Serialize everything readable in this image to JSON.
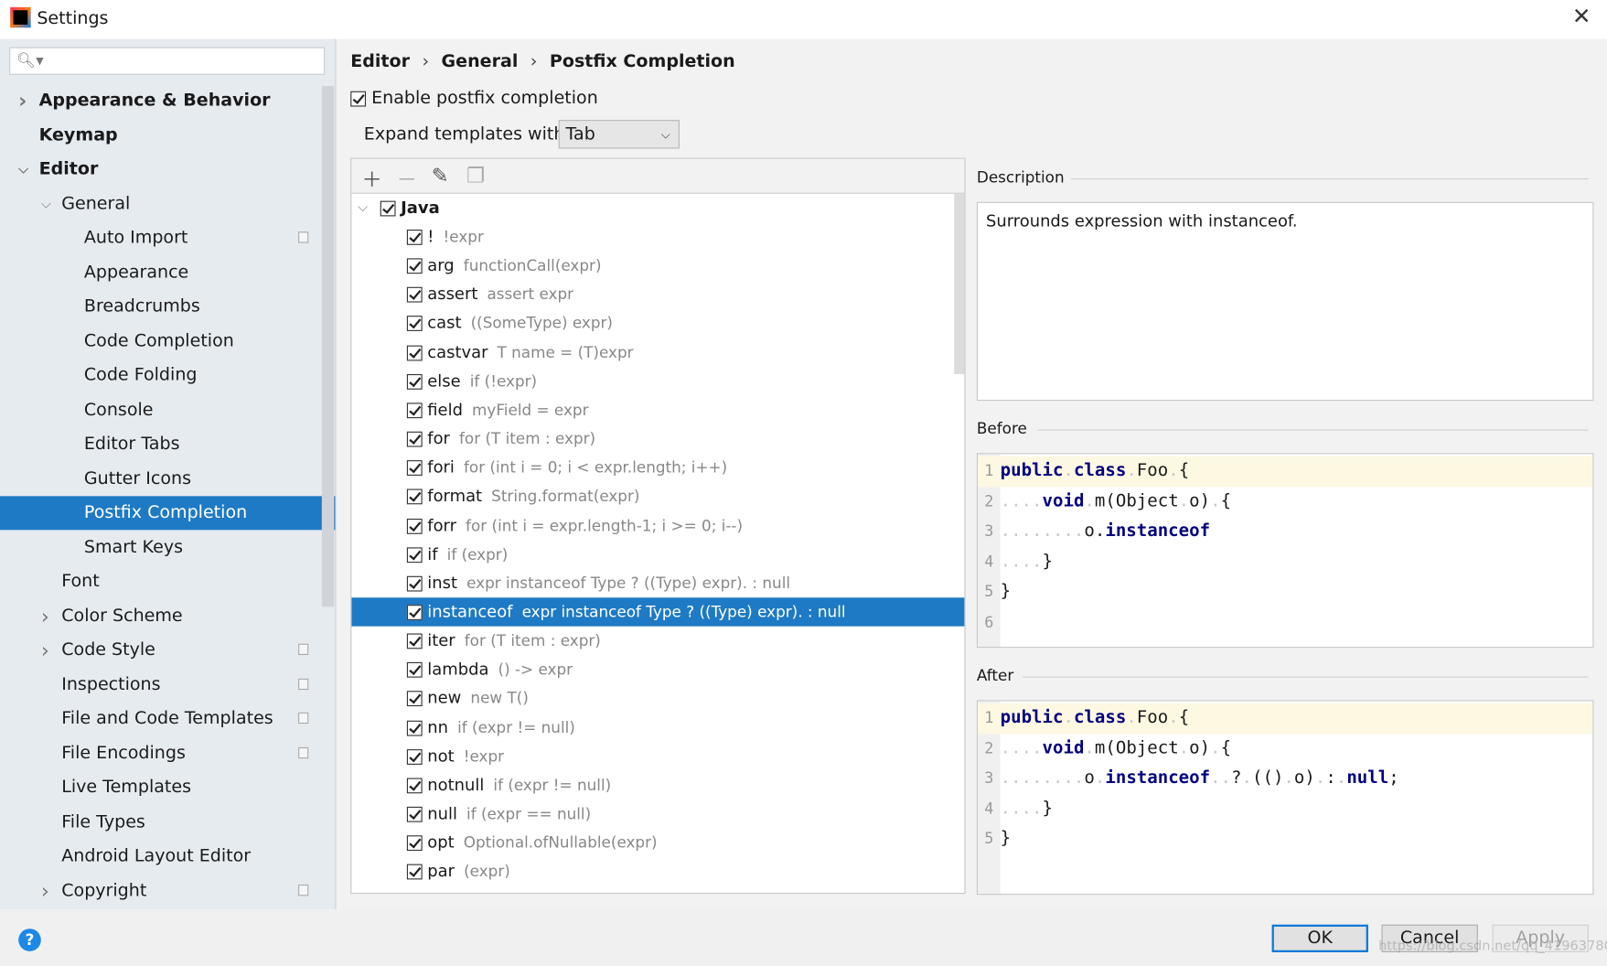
{
  "window": {
    "title": "Settings"
  },
  "sidebar": {
    "search_placeholder": "",
    "items": [
      {
        "label": "Appearance & Behavior",
        "level": 0,
        "bold": true,
        "chevron": "right"
      },
      {
        "label": "Keymap",
        "level": 0,
        "bold": true
      },
      {
        "label": "Editor",
        "level": 0,
        "bold": true,
        "chevron": "down"
      },
      {
        "label": "General",
        "level": 1,
        "chevron": "down"
      },
      {
        "label": "Auto Import",
        "level": 2,
        "project": true
      },
      {
        "label": "Appearance",
        "level": 2
      },
      {
        "label": "Breadcrumbs",
        "level": 2
      },
      {
        "label": "Code Completion",
        "level": 2
      },
      {
        "label": "Code Folding",
        "level": 2
      },
      {
        "label": "Console",
        "level": 2
      },
      {
        "label": "Editor Tabs",
        "level": 2
      },
      {
        "label": "Gutter Icons",
        "level": 2
      },
      {
        "label": "Postfix Completion",
        "level": 2,
        "selected": true
      },
      {
        "label": "Smart Keys",
        "level": 2
      },
      {
        "label": "Font",
        "level": 1
      },
      {
        "label": "Color Scheme",
        "level": 1,
        "chevron": "right"
      },
      {
        "label": "Code Style",
        "level": 1,
        "chevron": "right",
        "project": true
      },
      {
        "label": "Inspections",
        "level": 1,
        "project": true
      },
      {
        "label": "File and Code Templates",
        "level": 1,
        "project": true
      },
      {
        "label": "File Encodings",
        "level": 1,
        "project": true
      },
      {
        "label": "Live Templates",
        "level": 1
      },
      {
        "label": "File Types",
        "level": 1
      },
      {
        "label": "Android Layout Editor",
        "level": 1
      },
      {
        "label": "Copyright",
        "level": 1,
        "chevron": "right",
        "project": true
      }
    ]
  },
  "breadcrumb": [
    "Editor",
    "General",
    "Postfix Completion"
  ],
  "enable_label": "Enable postfix completion",
  "enable_checked": true,
  "expand": {
    "label": "Expand templates with",
    "value": "Tab"
  },
  "toolbar": {
    "icons": [
      "plus-icon",
      "minus-icon",
      "pencil-icon",
      "copy-icon"
    ]
  },
  "templates": {
    "group": "Java",
    "items": [
      {
        "key": "!",
        "desc": "!expr"
      },
      {
        "key": "arg",
        "desc": "functionCall(expr)"
      },
      {
        "key": "assert",
        "desc": "assert expr"
      },
      {
        "key": "cast",
        "desc": "((SomeType) expr)"
      },
      {
        "key": "castvar",
        "desc": "T name = (T)expr"
      },
      {
        "key": "else",
        "desc": "if (!expr)"
      },
      {
        "key": "field",
        "desc": "myField = expr"
      },
      {
        "key": "for",
        "desc": "for (T item : expr)"
      },
      {
        "key": "fori",
        "desc": "for (int i = 0; i < expr.length; i++)"
      },
      {
        "key": "format",
        "desc": "String.format(expr)"
      },
      {
        "key": "forr",
        "desc": "for (int i = expr.length-1; i >= 0; i--)"
      },
      {
        "key": "if",
        "desc": "if (expr)"
      },
      {
        "key": "inst",
        "desc": "expr instanceof Type ? ((Type) expr). : null"
      },
      {
        "key": "instanceof",
        "desc": "expr instanceof Type ? ((Type) expr). : null",
        "selected": true
      },
      {
        "key": "iter",
        "desc": "for (T item : expr)"
      },
      {
        "key": "lambda",
        "desc": "() -> expr"
      },
      {
        "key": "new",
        "desc": "new T()"
      },
      {
        "key": "nn",
        "desc": "if (expr != null)"
      },
      {
        "key": "not",
        "desc": "!expr"
      },
      {
        "key": "notnull",
        "desc": "if (expr != null)"
      },
      {
        "key": "null",
        "desc": "if (expr == null)"
      },
      {
        "key": "opt",
        "desc": "Optional.ofNullable(expr)"
      },
      {
        "key": "par",
        "desc": "(expr)"
      }
    ]
  },
  "description": {
    "label": "Description",
    "text": "Surrounds expression with instanceof."
  },
  "before": {
    "label": "Before",
    "lines": [
      [
        [
          "kw",
          "public"
        ],
        [
          "dot",
          "."
        ],
        [
          "kw",
          "class"
        ],
        [
          "dot",
          "."
        ],
        [
          "t",
          "Foo"
        ],
        [
          "dot",
          "."
        ],
        [
          "t",
          "{"
        ]
      ],
      [
        [
          "dot",
          "...."
        ],
        [
          "kw",
          "void"
        ],
        [
          "dot",
          "."
        ],
        [
          "t",
          "m(Object"
        ],
        [
          "dot",
          "."
        ],
        [
          "t",
          "o)"
        ],
        [
          "dot",
          "."
        ],
        [
          "t",
          "{"
        ]
      ],
      [
        [
          "dot",
          "........"
        ],
        [
          "t",
          "o."
        ],
        [
          "kw",
          "instanceof"
        ]
      ],
      [
        [
          "dot",
          "...."
        ],
        [
          "t",
          "}"
        ]
      ],
      [
        [
          "t",
          "}"
        ]
      ],
      []
    ]
  },
  "after": {
    "label": "After",
    "lines": [
      [
        [
          "kw",
          "public"
        ],
        [
          "dot",
          "."
        ],
        [
          "kw",
          "class"
        ],
        [
          "dot",
          "."
        ],
        [
          "t",
          "Foo"
        ],
        [
          "dot",
          "."
        ],
        [
          "t",
          "{"
        ]
      ],
      [
        [
          "dot",
          "...."
        ],
        [
          "kw",
          "void"
        ],
        [
          "dot",
          "."
        ],
        [
          "t",
          "m(Object"
        ],
        [
          "dot",
          "."
        ],
        [
          "t",
          "o)"
        ],
        [
          "dot",
          "."
        ],
        [
          "t",
          "{"
        ]
      ],
      [
        [
          "dot",
          "........"
        ],
        [
          "t",
          "o"
        ],
        [
          "dot",
          "."
        ],
        [
          "kw",
          "instanceof"
        ],
        [
          "dot",
          ".."
        ],
        [
          "t",
          "?"
        ],
        [
          "dot",
          "."
        ],
        [
          "t",
          "(()"
        ],
        [
          "dot",
          "."
        ],
        [
          "t",
          "o)"
        ],
        [
          "dot",
          "."
        ],
        [
          "t",
          ":"
        ],
        [
          "dot",
          "."
        ],
        [
          "kw",
          "null"
        ],
        [
          "t",
          ";"
        ]
      ],
      [
        [
          "dot",
          "...."
        ],
        [
          "t",
          "}"
        ]
      ],
      [
        [
          "t",
          "}"
        ]
      ]
    ]
  },
  "buttons": {
    "ok": "OK",
    "cancel": "Cancel",
    "apply": "Apply",
    "help": "?"
  },
  "watermark": "https://blog.csdn.net/qq_41963780",
  "colors": {
    "accent": "#1e7ac4",
    "sidebar_bg": "#e6ebf0",
    "keyword": "#000080",
    "current_line": "#fdf8e2"
  }
}
